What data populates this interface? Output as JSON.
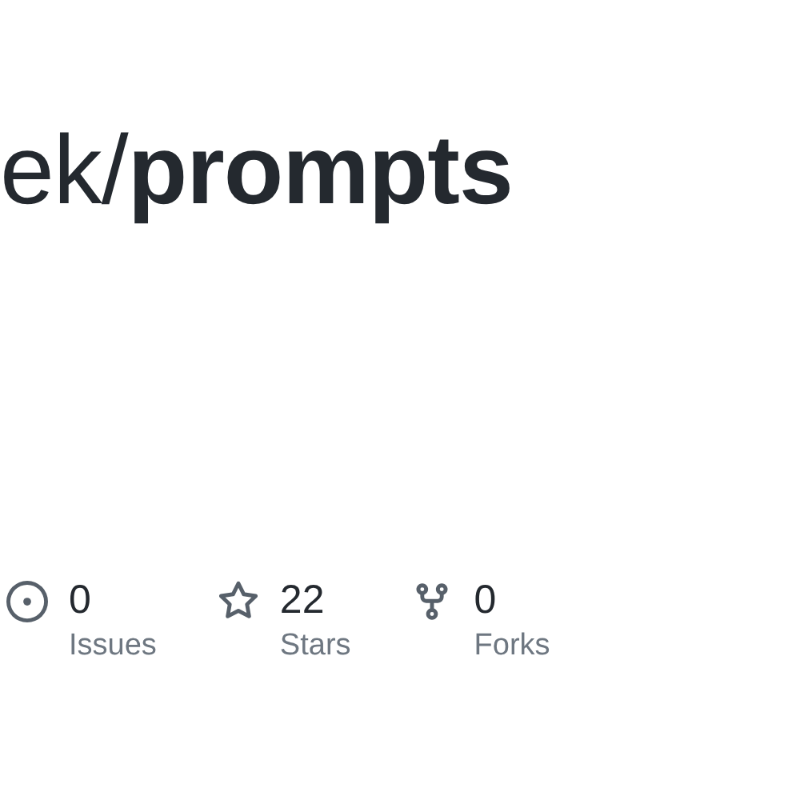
{
  "repo_title": "ek/**prompts**",
  "stats": [
    {
      "kind": "issues",
      "count": "0",
      "label": "Issues"
    },
    {
      "kind": "stars",
      "count": "22",
      "label": "Stars"
    },
    {
      "kind": "forks",
      "count": "0",
      "label": "Forks"
    }
  ]
}
